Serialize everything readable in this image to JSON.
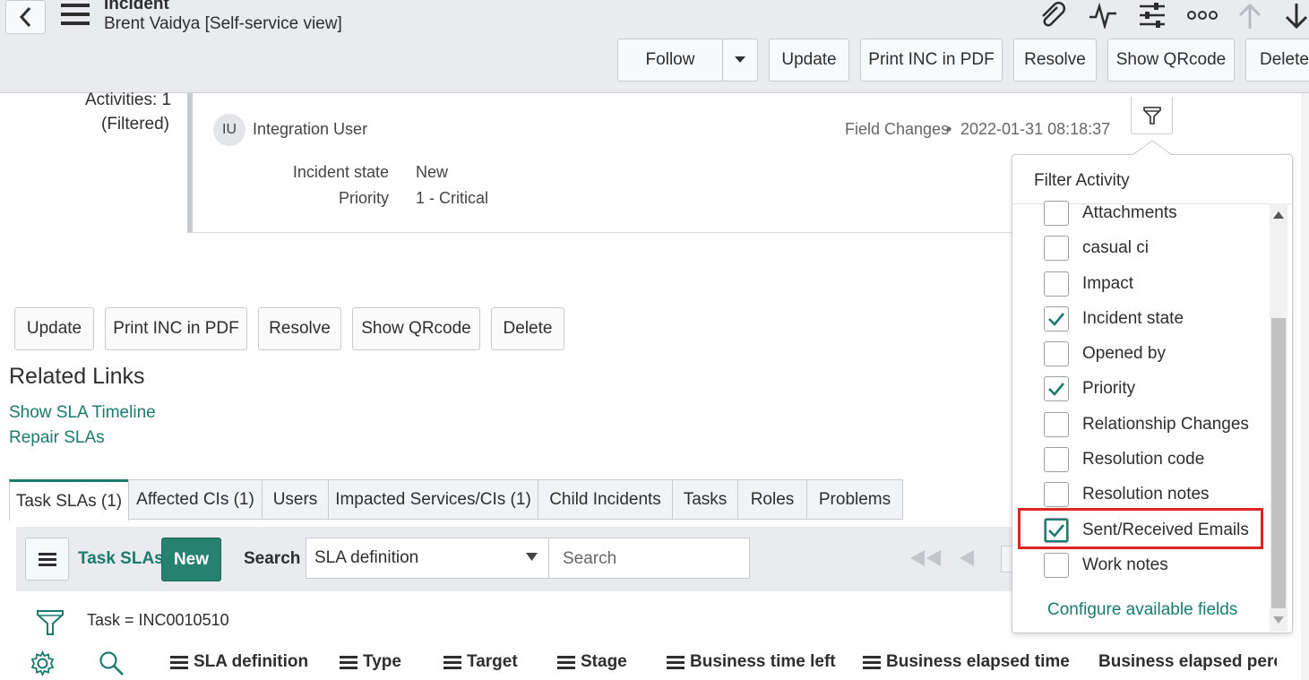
{
  "header": {
    "title": "Incident",
    "subtitle": "Brent Vaidya [Self-service view]",
    "buttons": {
      "follow": "Follow",
      "update": "Update",
      "print": "Print INC in PDF",
      "resolve": "Resolve",
      "qrcode": "Show QRcode",
      "delete": "Delete"
    }
  },
  "activity": {
    "count_label": "Activities: 1",
    "filtered_label": "(Filtered)",
    "avatar_initials": "IU",
    "user": "Integration User",
    "change_type": "Field Changes",
    "separator": "•",
    "timestamp": "2022-01-31 08:18:37",
    "fields": [
      {
        "label": "Incident state",
        "value": "New"
      },
      {
        "label": "Priority",
        "value": "1 - Critical"
      }
    ]
  },
  "form_buttons": {
    "update": "Update",
    "print": "Print INC in PDF",
    "resolve": "Resolve",
    "qrcode": "Show QRcode",
    "delete": "Delete"
  },
  "related_links": {
    "heading": "Related Links",
    "links": [
      "Show SLA Timeline",
      "Repair SLAs"
    ]
  },
  "tabs": [
    "Task SLAs (1)",
    "Affected CIs (1)",
    "Users",
    "Impacted Services/CIs (1)",
    "Child Incidents",
    "Tasks",
    "Roles",
    "Problems"
  ],
  "list": {
    "title": "Task SLAs",
    "new_label": "New",
    "search_label": "Search",
    "search_field": "SLA definition",
    "search_placeholder": "Search",
    "filter_text": "Task = INC0010510",
    "columns": [
      "SLA definition",
      "Type",
      "Target",
      "Stage",
      "Business time left",
      "Business elapsed time",
      "Business elapsed perc"
    ]
  },
  "filter_activity": {
    "title": "Filter Activity",
    "items": [
      {
        "label": "Attachments",
        "checked": false
      },
      {
        "label": "casual ci",
        "checked": false
      },
      {
        "label": "Impact",
        "checked": false
      },
      {
        "label": "Incident state",
        "checked": true
      },
      {
        "label": "Opened by",
        "checked": false
      },
      {
        "label": "Priority",
        "checked": true
      },
      {
        "label": "Relationship Changes",
        "checked": false
      },
      {
        "label": "Resolution code",
        "checked": false
      },
      {
        "label": "Resolution notes",
        "checked": false
      },
      {
        "label": "Sent/Received Emails",
        "checked": true
      },
      {
        "label": "Work notes",
        "checked": false
      }
    ],
    "configure_link": "Configure available fields"
  },
  "colors": {
    "accent": "#1b7a6e",
    "highlight": "#e02424",
    "header_bg": "#e9ebee"
  }
}
